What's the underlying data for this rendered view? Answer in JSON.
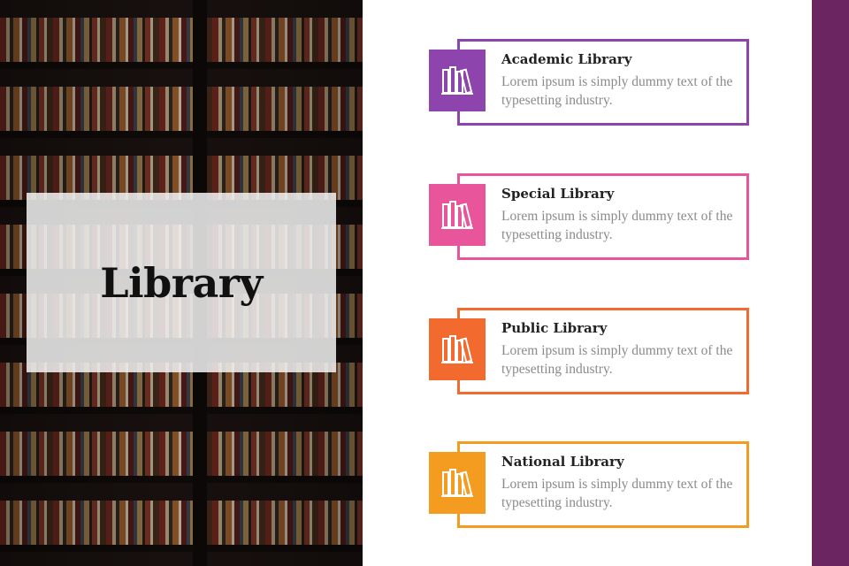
{
  "slide": {
    "title": "Library"
  },
  "colors": {
    "accent_bar": "#6b2560",
    "academic": "#8e44ad",
    "special": "#e8559a",
    "public": "#f26a2e",
    "national": "#f39c1f"
  },
  "cards": [
    {
      "heading": "Academic Library",
      "text": "Lorem ipsum is simply dummy text of the typesetting industry.",
      "icon": "books-icon"
    },
    {
      "heading": "Special Library",
      "text": "Lorem ipsum is simply dummy text of the typesetting industry.",
      "icon": "books-icon"
    },
    {
      "heading": "Public Library",
      "text": "Lorem ipsum is simply dummy text of the typesetting industry.",
      "icon": "books-icon"
    },
    {
      "heading": "National Library",
      "text": "Lorem ipsum is simply dummy text of the typesetting industry.",
      "icon": "books-icon"
    }
  ]
}
